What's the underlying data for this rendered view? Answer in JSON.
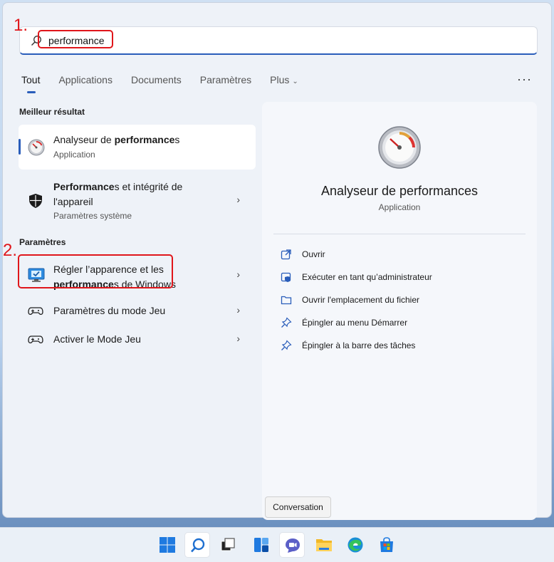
{
  "search": {
    "value": "performance"
  },
  "annotations": {
    "step1": "1.",
    "step2": "2."
  },
  "tabs": [
    {
      "label": "Tout",
      "active": true
    },
    {
      "label": "Applications"
    },
    {
      "label": "Documents"
    },
    {
      "label": "Paramètres"
    },
    {
      "label": "Plus"
    }
  ],
  "sections": {
    "best_match": "Meilleur résultat",
    "settings": "Paramètres"
  },
  "best_result": {
    "prefix": "Analyseur de ",
    "bold": "performance",
    "suffix": "s",
    "subtitle": "Application"
  },
  "device_health": {
    "bold": "Performance",
    "rest_line1": "s et intégrité de",
    "line2": "l'appareil",
    "subtitle": "Paramètres système"
  },
  "settings_items": [
    {
      "line1": "Régler l’apparence et les",
      "bold": "performance",
      "rest_line2": "s de Windows"
    },
    {
      "label": "Paramètres du mode Jeu"
    },
    {
      "label": "Activer le Mode Jeu"
    }
  ],
  "detail": {
    "title": "Analyseur de performances",
    "subtitle": "Application",
    "actions": [
      {
        "label": "Ouvrir",
        "icon": "open-icon"
      },
      {
        "label": "Exécuter en tant qu’administrateur",
        "icon": "shield-admin-icon"
      },
      {
        "label": "Ouvrir l'emplacement du fichier",
        "icon": "folder-icon"
      },
      {
        "label": "Épingler au menu Démarrer",
        "icon": "pin-icon"
      },
      {
        "label": "Épingler à la barre des tâches",
        "icon": "pin-icon"
      }
    ]
  },
  "tooltip": "Conversation",
  "taskbar": [
    "windows-start-icon",
    "search-icon",
    "task-view-icon",
    "widgets-icon",
    "chat-icon",
    "file-explorer-icon",
    "edge-icon",
    "store-icon"
  ],
  "colors": {
    "accent": "#2a5dba",
    "annotation": "#e0161b"
  }
}
